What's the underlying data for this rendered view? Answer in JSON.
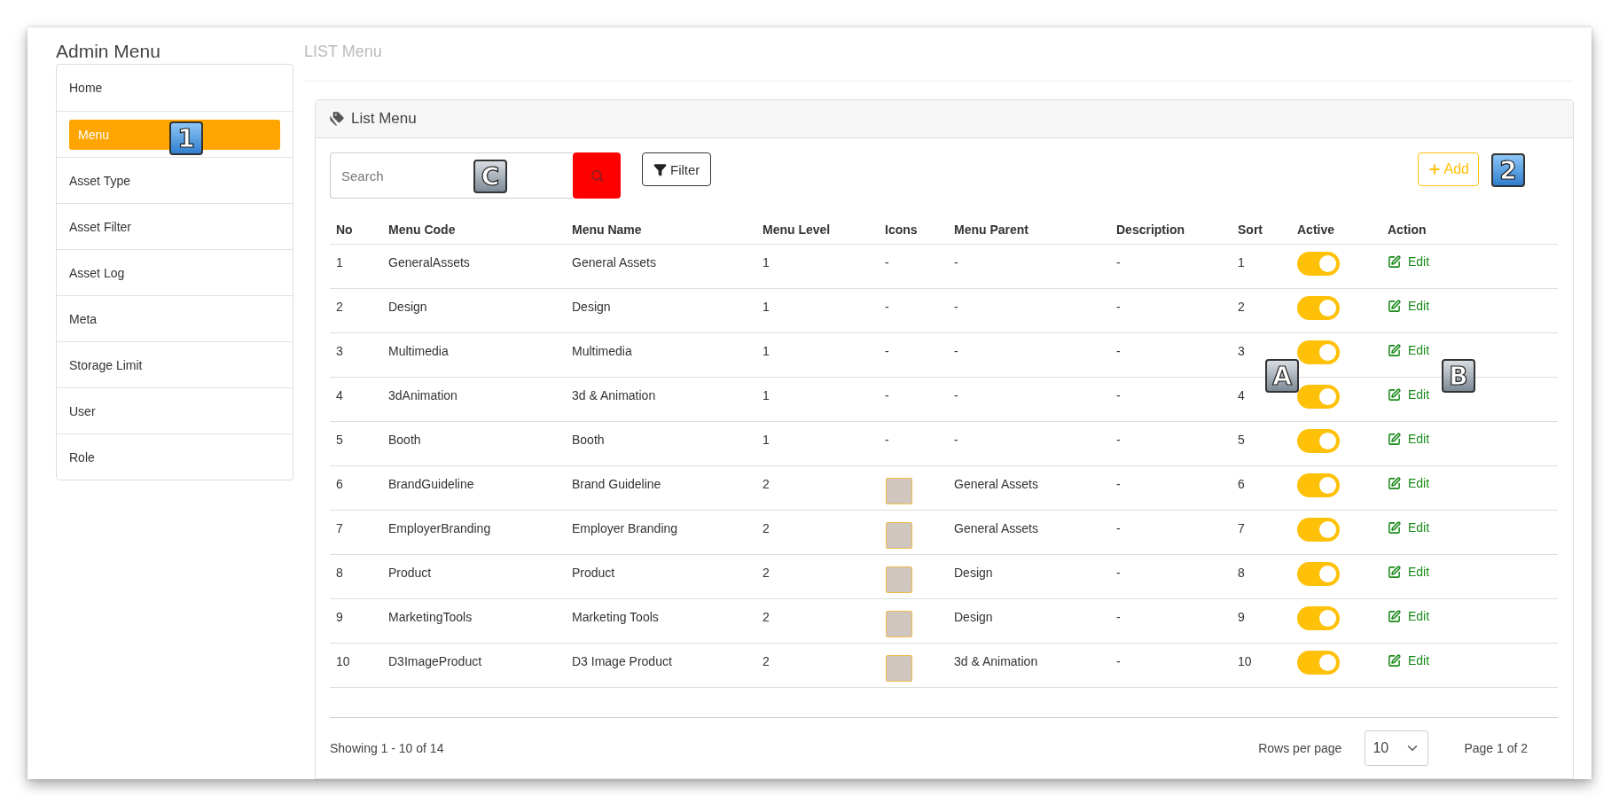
{
  "sidebar": {
    "title": "Admin Menu",
    "items": [
      {
        "label": "Home",
        "selected": false
      },
      {
        "label": "Menu",
        "selected": true
      },
      {
        "label": "Asset Type",
        "selected": false
      },
      {
        "label": "Asset Filter",
        "selected": false
      },
      {
        "label": "Asset Log",
        "selected": false
      },
      {
        "label": "Meta",
        "selected": false
      },
      {
        "label": "Storage Limit",
        "selected": false
      },
      {
        "label": "User",
        "selected": false
      },
      {
        "label": "Role",
        "selected": false
      }
    ]
  },
  "page_title": "LIST Menu",
  "card": {
    "title": "List Menu",
    "search": {
      "placeholder": "Search"
    },
    "filter_button": "Filter",
    "add_button": "Add",
    "table": {
      "columns": [
        "No",
        "Menu Code",
        "Menu Name",
        "Menu Level",
        "Icons",
        "Menu Parent",
        "Description",
        "Sort",
        "Active",
        "Action"
      ],
      "rows": [
        {
          "no": "1",
          "code": "GeneralAssets",
          "name": "General Assets",
          "level_text": "1",
          "icon": {
            "kind": "text",
            "text": "-"
          },
          "parent": "-",
          "description": "-",
          "sort": "1",
          "active": true,
          "action": "Edit"
        },
        {
          "no": "2",
          "code": "Design",
          "name": "Design",
          "level_text": "1",
          "icon": {
            "kind": "text",
            "text": "-"
          },
          "parent": "-",
          "description": "-",
          "sort": "2",
          "active": true,
          "action": "Edit"
        },
        {
          "no": "3",
          "code": "Multimedia",
          "name": "Multimedia",
          "level_text": "1",
          "icon": {
            "kind": "text",
            "text": "-"
          },
          "parent": "-",
          "description": "-",
          "sort": "3",
          "active": true,
          "action": "Edit"
        },
        {
          "no": "4",
          "code": "3dAnimation",
          "name": "3d & Animation",
          "level_text": "1",
          "icon": {
            "kind": "text",
            "text": "-"
          },
          "parent": "-",
          "description": "-",
          "sort": "4",
          "active": true,
          "action": "Edit"
        },
        {
          "no": "5",
          "code": "Booth",
          "name": "Booth",
          "level_text": "1",
          "icon": {
            "kind": "text",
            "text": "-"
          },
          "parent": "-",
          "description": "-",
          "sort": "5",
          "active": true,
          "action": "Edit"
        },
        {
          "no": "6",
          "code": "BrandGuideline",
          "name": "Brand Guideline",
          "level_text": "2",
          "icon": {
            "kind": "image"
          },
          "parent": "General Assets",
          "description": "-",
          "sort": "6",
          "active": true,
          "action": "Edit"
        },
        {
          "no": "7",
          "code": "EmployerBranding",
          "name": "Employer Branding",
          "level_text": "2",
          "icon": {
            "kind": "image"
          },
          "parent": "General Assets",
          "description": "-",
          "sort": "7",
          "active": true,
          "action": "Edit"
        },
        {
          "no": "8",
          "code": "Product",
          "name": "Product",
          "level_text": "2",
          "icon": {
            "kind": "image"
          },
          "parent": "Design",
          "description": "-",
          "sort": "8",
          "active": true,
          "action": "Edit"
        },
        {
          "no": "9",
          "code": "MarketingTools",
          "name": "Marketing Tools",
          "level_text": "2",
          "icon": {
            "kind": "image"
          },
          "parent": "Design",
          "description": "-",
          "sort": "9",
          "active": true,
          "action": "Edit"
        },
        {
          "no": "10",
          "code": "D3ImageProduct",
          "name": "D3 Image Product",
          "level_text": "2",
          "icon": {
            "kind": "image"
          },
          "parent": "3d & Animation",
          "description": "-",
          "sort": "10",
          "active": true,
          "action": "Edit"
        }
      ]
    },
    "footer": {
      "showing": "Showing 1 - 10 of 14",
      "rows_per_page_label": "Rows per page",
      "rows_per_page": "10",
      "page": "Page 1 of 2"
    }
  },
  "callouts": [
    "1",
    "C",
    "2",
    "A",
    "B"
  ]
}
